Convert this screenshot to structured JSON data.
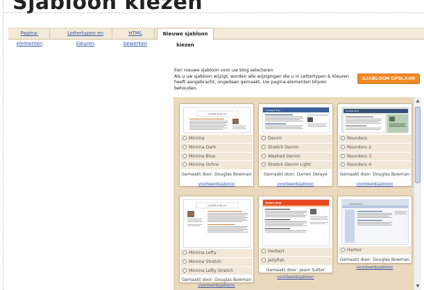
{
  "header": {
    "title": "Sjabloon kiezen"
  },
  "tabs": [
    {
      "label": "Pagina-elementen",
      "active": false
    },
    {
      "label": "Lettertypen en kleuren",
      "active": false
    },
    {
      "label": "HTML bewerken",
      "active": false
    },
    {
      "label": "Nieuwe sjabloon kiezen",
      "active": true
    }
  ],
  "intro": {
    "line1": "Een nieuwe sjabloon voor uw blog selecteren.",
    "line2": "Als u uw sjabloon wijzigt, worden alle wijzigingen die u in Lettertypen & Kleuren heeft aangebracht, ongedaan gemaakt. Uw pagina-elementen blijven behouden."
  },
  "save_button": {
    "label": "SJABLOON OPSLAAN",
    "color": "#f08a24"
  },
  "templates": [
    {
      "name": "minima",
      "thumb_title": "SAMPLE BLOG",
      "options": [
        "Minima",
        "Minima Dark",
        "Minima Blue",
        "Minima Ochre"
      ],
      "author": "Gemaakt door: Douglas Bowman",
      "preview": "voorbeeldsjabloon"
    },
    {
      "name": "denim",
      "thumb_title": "A Sample Blog",
      "options": [
        "Denim",
        "Stretch Denim",
        "Washed Denim",
        "Stretch Denim Light"
      ],
      "author": "Gemaakt door: Darren Delaye",
      "preview": "voorbeeldsjabloon"
    },
    {
      "name": "rounders",
      "thumb_title": "Sample Blog",
      "options": [
        "Rounders",
        "Rounders 2",
        "Rounders 3",
        "Rounders 4"
      ],
      "author": "Gemaakt door: Douglas Bowman",
      "preview": "voorbeeldsjabloon"
    },
    {
      "name": "minima-lefty",
      "thumb_title": "SAMPLE BLOG",
      "options": [
        "Minima Lefty",
        "Minima Stretch",
        "Minima Lefty Stretch"
      ],
      "author": "Gemaakt door: Douglas Bowman",
      "preview": "voorbeeldsjabloon"
    },
    {
      "name": "herbert",
      "thumb_title": "Sample Blog",
      "options": [
        "Herbert",
        "Jellyfish"
      ],
      "author": "Gemaakt door: Jason Sutter",
      "preview": "voorbeeldsjabloon"
    },
    {
      "name": "harbor",
      "thumb_title": "Sample Blog",
      "options": [
        "Harbor"
      ],
      "author": "Gemaakt door: Douglas Bowman",
      "preview": "voorbeeldsjabloon"
    }
  ],
  "icons": {
    "scroll_up": "▲",
    "scroll_down": "▼"
  }
}
